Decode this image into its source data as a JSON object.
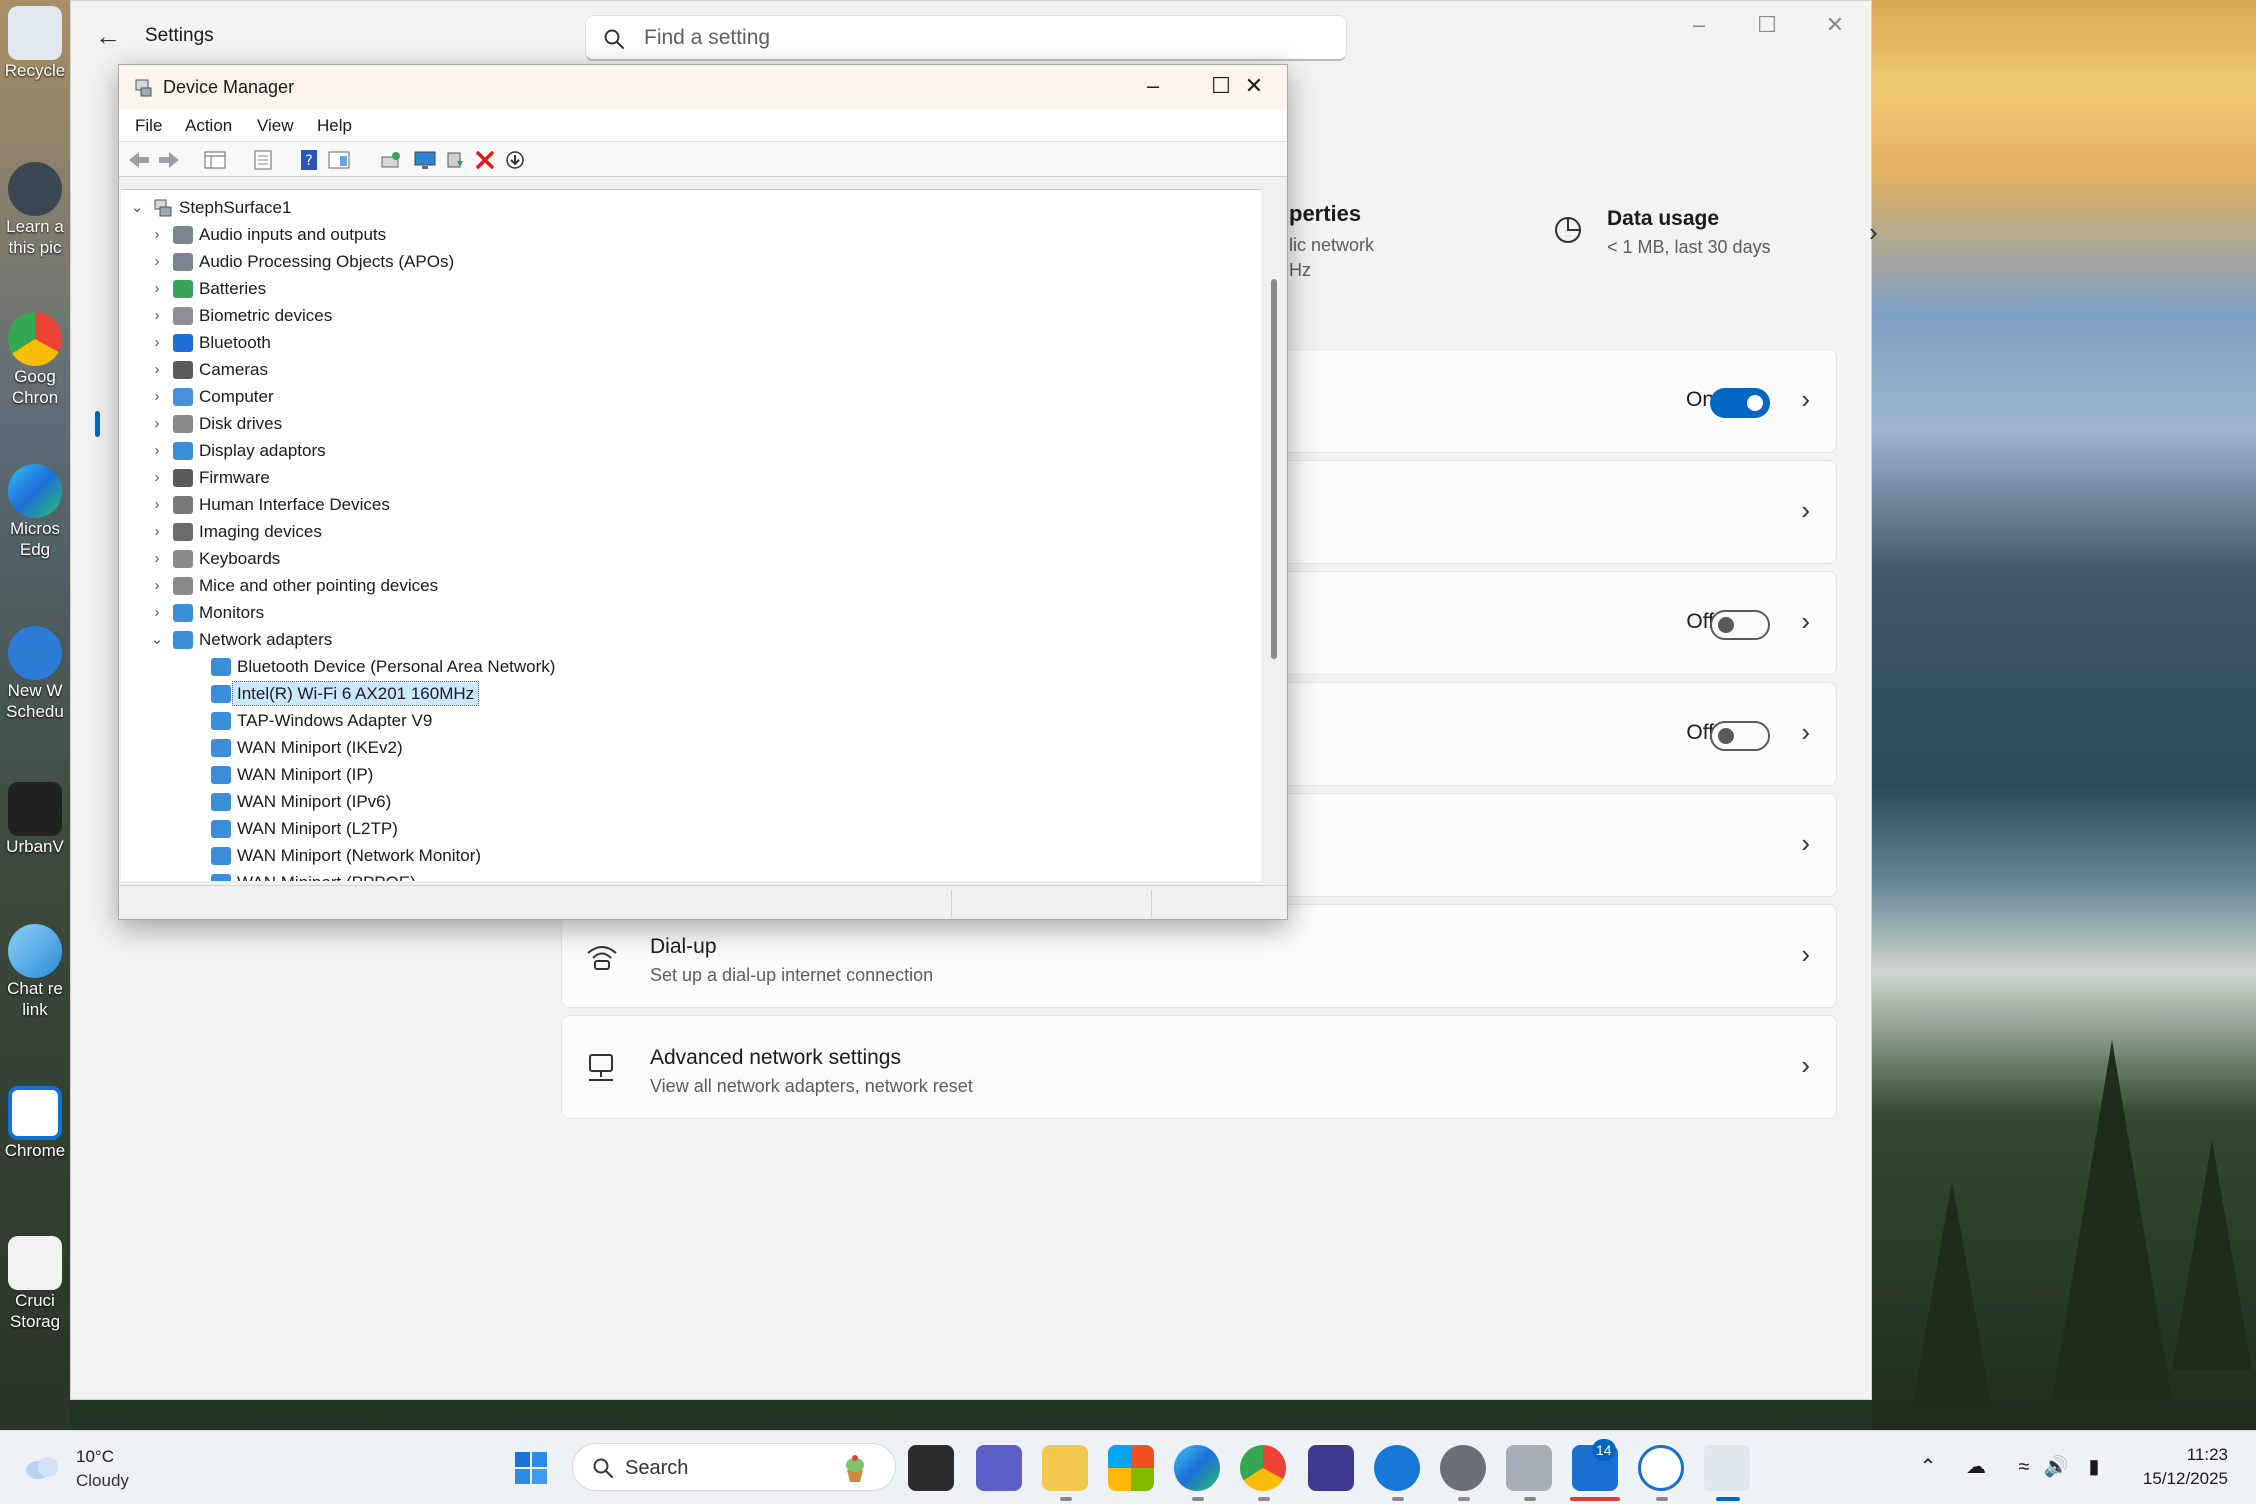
{
  "desktop": {
    "icons": [
      {
        "label": "Recycle"
      },
      {
        "label": "Learn a"
      },
      {
        "label": "this pic"
      },
      {
        "label": "Goog"
      },
      {
        "label": "Chron"
      },
      {
        "label": "Micros"
      },
      {
        "label": "Edg"
      },
      {
        "label": "New W"
      },
      {
        "label": "Schedu"
      },
      {
        "label": "UrbanV"
      },
      {
        "label": "Chat re"
      },
      {
        "label": "link"
      },
      {
        "label": "Chrome"
      },
      {
        "label": "Cruci"
      },
      {
        "label": "Storag"
      }
    ]
  },
  "settings": {
    "title": "Settings",
    "search_placeholder": "Find a setting",
    "props_title": "perties",
    "props_line1": "lic network",
    "props_line2": "Hz",
    "data_usage": {
      "title": "Data usage",
      "subtitle": "< 1 MB, last 30 days"
    },
    "cards": [
      {
        "state": "On"
      },
      {},
      {
        "state": "Off"
      },
      {
        "state": "Off"
      },
      {},
      {
        "title": "Dial-up",
        "subtitle": "Set up a dial-up internet connection",
        "icon": "dialup-icon"
      },
      {
        "title": "Advanced network settings",
        "subtitle": "View all network adapters, network reset",
        "icon": "network-computer-icon"
      }
    ]
  },
  "device_manager": {
    "title": "Device Manager",
    "menu": [
      "File",
      "Action",
      "View",
      "Help"
    ],
    "root": "StephSurface1",
    "categories": [
      "Audio inputs and outputs",
      "Audio Processing Objects (APOs)",
      "Batteries",
      "Biometric devices",
      "Bluetooth",
      "Cameras",
      "Computer",
      "Disk drives",
      "Display adaptors",
      "Firmware",
      "Human Interface Devices",
      "Imaging devices",
      "Keyboards",
      "Mice and other pointing devices",
      "Monitors",
      "Network adapters"
    ],
    "network_adapters": [
      "Bluetooth Device (Personal Area Network)",
      "Intel(R) Wi-Fi 6 AX201 160MHz",
      "TAP-Windows Adapter V9",
      "WAN Miniport (IKEv2)",
      "WAN Miniport (IP)",
      "WAN Miniport (IPv6)",
      "WAN Miniport (L2TP)",
      "WAN Miniport (Network Monitor)",
      "WAN Miniport (PPPOE)"
    ],
    "selected": "Intel(R) Wi-Fi 6 AX201 160MHz"
  },
  "taskbar": {
    "weather": {
      "temp": "10°C",
      "condition": "Cloudy"
    },
    "search_label": "Search",
    "teams_badge": "14",
    "time": "11:23",
    "date": "15/12/2025"
  },
  "colors": {
    "accent": "#0067c0",
    "selection": "#cce8ff"
  }
}
